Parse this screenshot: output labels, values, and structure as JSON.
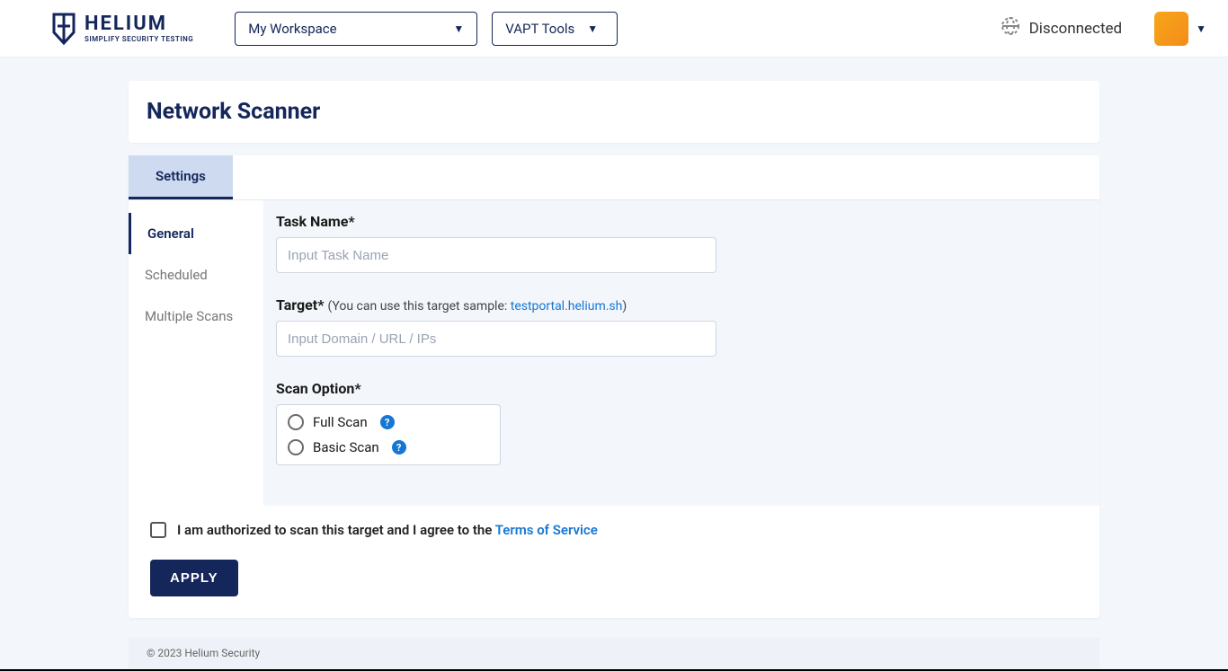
{
  "header": {
    "brand": "HELIUM",
    "tagline": "SIMPLIFY SECURITY TESTING",
    "workspace_selected": "My Workspace",
    "tools_label": "VAPT Tools",
    "connection_status": "Disconnected"
  },
  "page": {
    "title": "Network Scanner",
    "tabs": [
      {
        "label": "Settings",
        "active": true
      }
    ],
    "sidemenu": [
      {
        "label": "General",
        "active": true
      },
      {
        "label": "Scheduled",
        "active": false
      },
      {
        "label": "Multiple Scans",
        "active": false
      }
    ]
  },
  "form": {
    "task_name": {
      "label": "Task Name*",
      "placeholder": "Input Task Name",
      "value": ""
    },
    "target": {
      "label": "Target*",
      "hint_prefix": "(You can use this target sample: ",
      "hint_link": "testportal.helium.sh",
      "hint_suffix": ")",
      "placeholder": "Input Domain / URL / IPs",
      "value": ""
    },
    "scan_option": {
      "label": "Scan Option*",
      "options": [
        "Full Scan",
        "Basic Scan"
      ]
    },
    "authorize": {
      "text_prefix": "I am authorized to scan this target and I agree to the ",
      "link": "Terms of Service",
      "checked": false
    },
    "apply_label": "APPLY"
  },
  "footer": {
    "copyright": "© 2023 Helium Security"
  }
}
